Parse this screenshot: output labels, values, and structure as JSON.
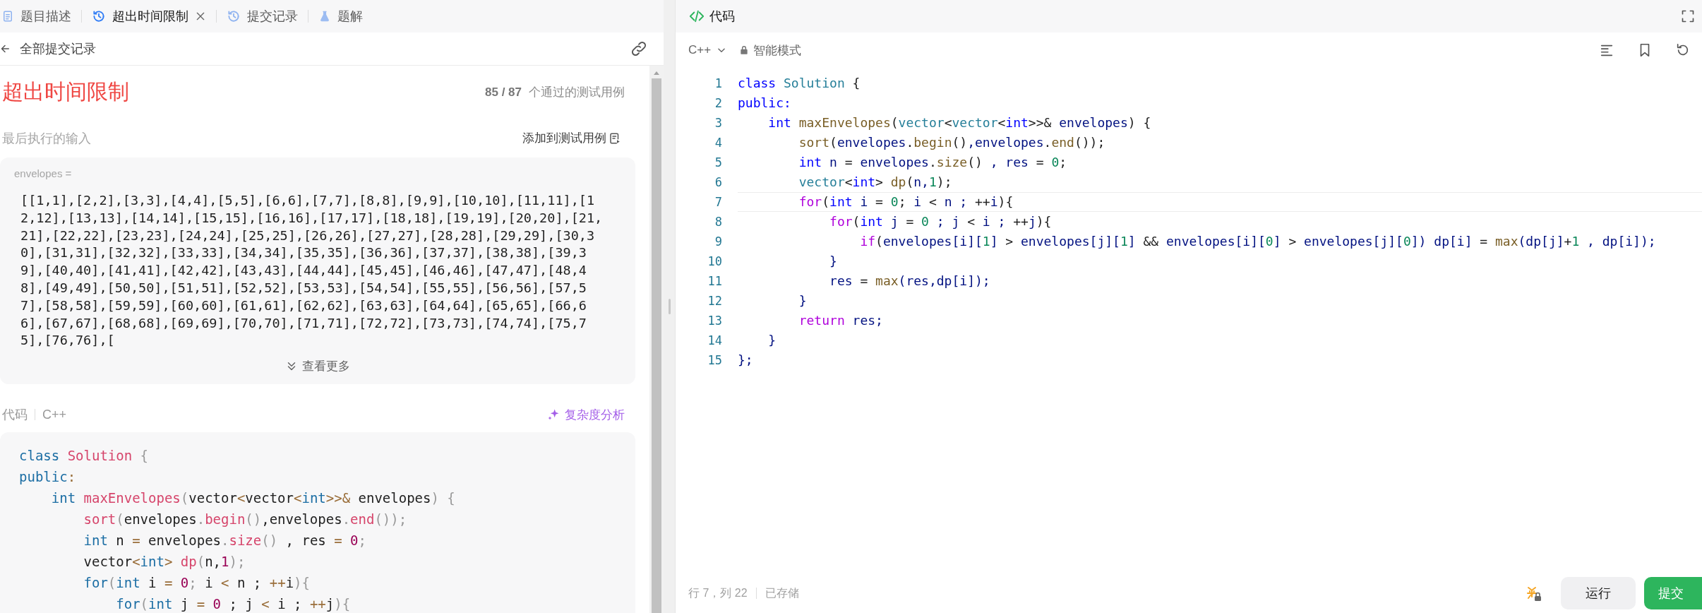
{
  "tabs": [
    {
      "label": "题目描述",
      "selected": false
    },
    {
      "label": "超出时间限制",
      "selected": true
    },
    {
      "label": "提交记录",
      "selected": false
    },
    {
      "label": "题解",
      "selected": false
    }
  ],
  "back_link": "全部提交记录",
  "result": {
    "status": "超出时间限制",
    "passed": "85 / 87",
    "passed_label": "个通过的测试用例"
  },
  "last_input": {
    "label": "最后执行的输入",
    "add_button": "添加到测试用例",
    "variable": "envelopes =",
    "value": "[[1,1],[2,2],[3,3],[4,4],[5,5],[6,6],[7,7],[8,8],[9,9],[10,10],[11,11],[12,12],[13,13],[14,14],[15,15],[16,16],[17,17],[18,18],[19,19],[20,20],[21,21],[22,22],[23,23],[24,24],[25,25],[26,26],[27,27],[28,28],[29,29],[30,30],[31,31],[32,32],[33,33],[34,34],[35,35],[36,36],[37,37],[38,38],[39,39],[40,40],[41,41],[42,42],[43,43],[44,44],[45,45],[46,46],[47,47],[48,48],[49,49],[50,50],[51,51],[52,52],[53,53],[54,54],[55,55],[56,56],[57,57],[58,58],[59,59],[60,60],[61,61],[62,62],[63,63],[64,64],[65,65],[66,66],[67,67],[68,68],[69,69],[70,70],[71,71],[72,72],[73,73],[74,74],[75,75],[76,76],[",
    "show_more": "查看更多"
  },
  "submitted_code": {
    "label": "代码",
    "language": "C++",
    "analysis_button": "复杂度分析",
    "lines": [
      [
        {
          "kind": "kw",
          "text": "class"
        },
        {
          "kind": "cls",
          "text": " Solution"
        },
        {
          "kind": "punc",
          "text": " {"
        }
      ],
      [
        {
          "kind": "kw",
          "text": "public"
        },
        {
          "kind": "op",
          "text": ":"
        }
      ],
      [
        {
          "kind": "kw",
          "text": "    int"
        },
        {
          "kind": "fn",
          "text": " maxEnvelopes"
        },
        {
          "kind": "punc",
          "text": "("
        },
        {
          "kind": "type",
          "text": "vector"
        },
        {
          "kind": "op",
          "text": "<"
        },
        {
          "kind": "type",
          "text": "vector"
        },
        {
          "kind": "op",
          "text": "<"
        },
        {
          "kind": "kw",
          "text": "int"
        },
        {
          "kind": "op",
          "text": ">>&"
        },
        {
          "kind": "p",
          "text": " envelopes"
        },
        {
          "kind": "punc",
          "text": ") {"
        }
      ],
      [
        {
          "kind": "fn",
          "text": "        sort"
        },
        {
          "kind": "punc",
          "text": "("
        },
        {
          "kind": "p",
          "text": "envelopes"
        },
        {
          "kind": "punc",
          "text": "."
        },
        {
          "kind": "fn",
          "text": "begin"
        },
        {
          "kind": "punc",
          "text": "()"
        },
        {
          "kind": "p",
          "text": ",envelopes"
        },
        {
          "kind": "punc",
          "text": "."
        },
        {
          "kind": "fn",
          "text": "end"
        },
        {
          "kind": "punc",
          "text": "());"
        }
      ],
      [
        {
          "kind": "kw",
          "text": "        int"
        },
        {
          "kind": "p",
          "text": " n "
        },
        {
          "kind": "op",
          "text": "="
        },
        {
          "kind": "p",
          "text": " envelopes"
        },
        {
          "kind": "punc",
          "text": "."
        },
        {
          "kind": "fn",
          "text": "size"
        },
        {
          "kind": "punc",
          "text": "()"
        },
        {
          "kind": "p",
          "text": " , res "
        },
        {
          "kind": "op",
          "text": "="
        },
        {
          "kind": "num",
          "text": " 0"
        },
        {
          "kind": "punc",
          "text": ";"
        }
      ],
      [
        {
          "kind": "p",
          "text": "        vector"
        },
        {
          "kind": "op",
          "text": "<"
        },
        {
          "kind": "kw",
          "text": "int"
        },
        {
          "kind": "op",
          "text": ">"
        },
        {
          "kind": "fn",
          "text": " dp"
        },
        {
          "kind": "punc",
          "text": "("
        },
        {
          "kind": "p",
          "text": "n,"
        },
        {
          "kind": "num",
          "text": "1"
        },
        {
          "kind": "punc",
          "text": ");"
        }
      ],
      [
        {
          "kind": "ctl",
          "text": "        for"
        },
        {
          "kind": "punc",
          "text": "("
        },
        {
          "kind": "kw",
          "text": "int"
        },
        {
          "kind": "p",
          "text": " i "
        },
        {
          "kind": "op",
          "text": "="
        },
        {
          "kind": "num",
          "text": " 0"
        },
        {
          "kind": "punc",
          "text": ";"
        },
        {
          "kind": "p",
          "text": " i "
        },
        {
          "kind": "op",
          "text": "<"
        },
        {
          "kind": "p",
          "text": " n ; "
        },
        {
          "kind": "op",
          "text": "++"
        },
        {
          "kind": "p",
          "text": "i"
        },
        {
          "kind": "punc",
          "text": "){"
        }
      ],
      [
        {
          "kind": "ctl",
          "text": "            for"
        },
        {
          "kind": "punc",
          "text": "("
        },
        {
          "kind": "kw",
          "text": "int"
        },
        {
          "kind": "p",
          "text": " j "
        },
        {
          "kind": "op",
          "text": "="
        },
        {
          "kind": "num",
          "text": " 0"
        },
        {
          "kind": "p",
          "text": " ; j "
        },
        {
          "kind": "op",
          "text": "<"
        },
        {
          "kind": "p",
          "text": " i ; "
        },
        {
          "kind": "op",
          "text": "++"
        },
        {
          "kind": "p",
          "text": "j"
        },
        {
          "kind": "punc",
          "text": "){"
        }
      ]
    ]
  },
  "editor": {
    "title": "代码",
    "language": "C++",
    "mode": "智能模式",
    "lines": [
      {
        "number": "1",
        "current": false,
        "tokens": [
          {
            "kind": "kw",
            "text": "class"
          },
          {
            "kind": "cls",
            "text": " Solution"
          },
          {
            "kind": "punc",
            "text": " {"
          }
        ]
      },
      {
        "number": "2",
        "current": false,
        "tokens": [
          {
            "kind": "kw",
            "text": "public"
          },
          {
            "kind": "kw",
            "text": ":"
          }
        ]
      },
      {
        "number": "3",
        "current": false,
        "tokens": [
          {
            "kind": "kw",
            "text": "    int"
          },
          {
            "kind": "fn",
            "text": " maxEnvelopes"
          },
          {
            "kind": "punc",
            "text": "("
          },
          {
            "kind": "type",
            "text": "vector"
          },
          {
            "kind": "op",
            "text": "<"
          },
          {
            "kind": "type",
            "text": "vector"
          },
          {
            "kind": "op",
            "text": "<"
          },
          {
            "kind": "kw",
            "text": "int"
          },
          {
            "kind": "op",
            "text": ">>&"
          },
          {
            "kind": "p",
            "text": " envelopes"
          },
          {
            "kind": "punc",
            "text": ") {"
          }
        ]
      },
      {
        "number": "4",
        "current": false,
        "tokens": [
          {
            "kind": "fn",
            "text": "        sort"
          },
          {
            "kind": "punc",
            "text": "("
          },
          {
            "kind": "p",
            "text": "envelopes"
          },
          {
            "kind": "punc",
            "text": "."
          },
          {
            "kind": "fn",
            "text": "begin"
          },
          {
            "kind": "punc",
            "text": "()"
          },
          {
            "kind": "p",
            "text": ",envelopes"
          },
          {
            "kind": "punc",
            "text": "."
          },
          {
            "kind": "fn",
            "text": "end"
          },
          {
            "kind": "punc",
            "text": "());"
          }
        ]
      },
      {
        "number": "5",
        "current": false,
        "tokens": [
          {
            "kind": "kw",
            "text": "        int"
          },
          {
            "kind": "p",
            "text": " n "
          },
          {
            "kind": "op",
            "text": "="
          },
          {
            "kind": "p",
            "text": " envelopes"
          },
          {
            "kind": "punc",
            "text": "."
          },
          {
            "kind": "fn",
            "text": "size"
          },
          {
            "kind": "punc",
            "text": "()"
          },
          {
            "kind": "p",
            "text": " , res "
          },
          {
            "kind": "op",
            "text": "="
          },
          {
            "kind": "num",
            "text": " 0"
          },
          {
            "kind": "punc",
            "text": ";"
          }
        ]
      },
      {
        "number": "6",
        "current": false,
        "tokens": [
          {
            "kind": "type",
            "text": "        vector"
          },
          {
            "kind": "op",
            "text": "<"
          },
          {
            "kind": "kw",
            "text": "int"
          },
          {
            "kind": "op",
            "text": ">"
          },
          {
            "kind": "fn",
            "text": " dp"
          },
          {
            "kind": "punc",
            "text": "("
          },
          {
            "kind": "p",
            "text": "n,"
          },
          {
            "kind": "num",
            "text": "1"
          },
          {
            "kind": "punc",
            "text": ");"
          }
        ]
      },
      {
        "number": "7",
        "current": true,
        "tokens": [
          {
            "kind": "ctl",
            "text": "        for"
          },
          {
            "kind": "punc",
            "text": "("
          },
          {
            "kind": "kw",
            "text": "int"
          },
          {
            "kind": "p",
            "text": " i "
          },
          {
            "kind": "op",
            "text": "="
          },
          {
            "kind": "num",
            "text": " 0"
          },
          {
            "kind": "punc",
            "text": ";"
          },
          {
            "kind": "p",
            "text": " i "
          },
          {
            "kind": "op",
            "text": "<"
          },
          {
            "kind": "p",
            "text": " n ; "
          },
          {
            "kind": "op",
            "text": "++"
          },
          {
            "kind": "p",
            "text": "i"
          },
          {
            "kind": "punc",
            "text": "){"
          }
        ]
      },
      {
        "number": "8",
        "current": false,
        "tokens": [
          {
            "kind": "ctl",
            "text": "            for"
          },
          {
            "kind": "punc",
            "text": "("
          },
          {
            "kind": "kw",
            "text": "int"
          },
          {
            "kind": "p",
            "text": " j "
          },
          {
            "kind": "op",
            "text": "="
          },
          {
            "kind": "num",
            "text": " 0"
          },
          {
            "kind": "p",
            "text": " ; j "
          },
          {
            "kind": "op",
            "text": "<"
          },
          {
            "kind": "p",
            "text": " i ; "
          },
          {
            "kind": "op",
            "text": "++"
          },
          {
            "kind": "p",
            "text": "j"
          },
          {
            "kind": "punc",
            "text": "){"
          }
        ]
      },
      {
        "number": "9",
        "current": false,
        "tokens": [
          {
            "kind": "ctl",
            "text": "                if"
          },
          {
            "kind": "punc",
            "text": "("
          },
          {
            "kind": "p",
            "text": "envelopes[i]["
          },
          {
            "kind": "num",
            "text": "1"
          },
          {
            "kind": "p",
            "text": "] "
          },
          {
            "kind": "op",
            "text": ">"
          },
          {
            "kind": "p",
            "text": " envelopes[j]["
          },
          {
            "kind": "num",
            "text": "1"
          },
          {
            "kind": "p",
            "text": "] "
          },
          {
            "kind": "op",
            "text": "&&"
          },
          {
            "kind": "p",
            "text": " envelopes[i]["
          },
          {
            "kind": "num",
            "text": "0"
          },
          {
            "kind": "p",
            "text": "] "
          },
          {
            "kind": "op",
            "text": ">"
          },
          {
            "kind": "p",
            "text": " envelopes[j]["
          },
          {
            "kind": "num",
            "text": "0"
          },
          {
            "kind": "p",
            "text": "]) dp[i] "
          },
          {
            "kind": "op",
            "text": "="
          },
          {
            "kind": "fn",
            "text": " max"
          },
          {
            "kind": "p",
            "text": "(dp[j]"
          },
          {
            "kind": "op",
            "text": "+"
          },
          {
            "kind": "num",
            "text": "1"
          },
          {
            "kind": "p",
            "text": " , dp[i]);"
          }
        ]
      },
      {
        "number": "10",
        "current": false,
        "tokens": [
          {
            "kind": "p",
            "text": "            }"
          }
        ]
      },
      {
        "number": "11",
        "current": false,
        "tokens": [
          {
            "kind": "p",
            "text": "            res "
          },
          {
            "kind": "op",
            "text": "="
          },
          {
            "kind": "fn",
            "text": " max"
          },
          {
            "kind": "p",
            "text": "(res,dp[i]);"
          }
        ]
      },
      {
        "number": "12",
        "current": false,
        "tokens": [
          {
            "kind": "p",
            "text": "        }"
          }
        ]
      },
      {
        "number": "13",
        "current": false,
        "tokens": [
          {
            "kind": "ctl",
            "text": "        return"
          },
          {
            "kind": "p",
            "text": " res;"
          }
        ]
      },
      {
        "number": "14",
        "current": false,
        "tokens": [
          {
            "kind": "p",
            "text": "    }"
          }
        ]
      },
      {
        "number": "15",
        "current": false,
        "tokens": [
          {
            "kind": "p",
            "text": "};"
          }
        ]
      }
    ],
    "status": {
      "position": "行 7，列 22",
      "saved": "已存储"
    },
    "buttons": [
      {
        "label": "运行",
        "kind": "run"
      },
      {
        "label": "提交",
        "kind": "submit"
      }
    ]
  }
}
